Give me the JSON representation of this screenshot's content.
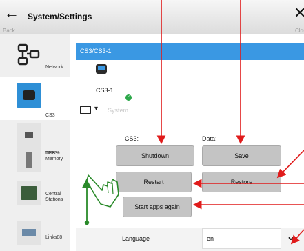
{
  "header": {
    "title": "System/Settings",
    "back_label": "Back",
    "close_label": "Close"
  },
  "sidebar": {
    "items": [
      {
        "label": "Network"
      },
      {
        "label": "CS3"
      },
      {
        "label": "TFP3"
      },
      {
        "label": "USB &\nMemory"
      },
      {
        "label": "Central\nStations"
      },
      {
        "label": "Links88"
      }
    ],
    "selected_index": 1
  },
  "main": {
    "device_bar": "CS3/CS3-1",
    "device_name": "CS3-1",
    "system_label": "System",
    "cs3_label": "CS3:",
    "data_label": "Data:",
    "buttons": {
      "shutdown": "Shutdown",
      "save": "Save",
      "restart": "Restart",
      "restore": "Restore",
      "start_apps": "Start apps again"
    },
    "language": {
      "label": "Language",
      "value": "en"
    }
  },
  "colors": {
    "accent_blue": "#3a98e3",
    "annotation_red": "#e01b1b",
    "annotation_green": "#2a8a2a",
    "button_gray": "#c4c4c4"
  }
}
